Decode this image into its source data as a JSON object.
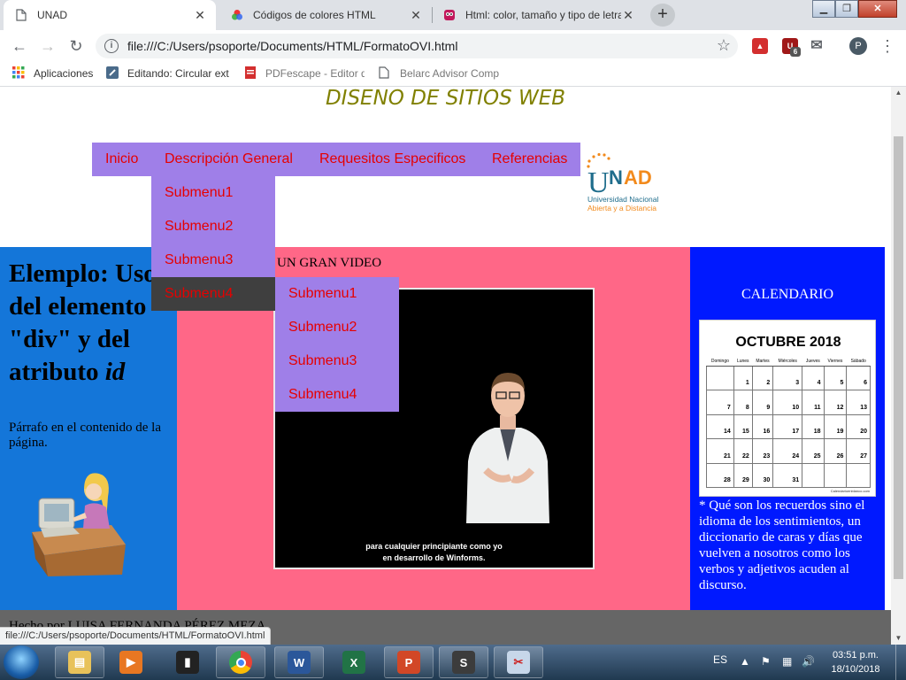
{
  "browser": {
    "tabs": [
      {
        "title": "UNAD",
        "active": true,
        "icon": "document-icon"
      },
      {
        "title": "Códigos de colores HTML",
        "active": false,
        "icon": "color-wheel-icon"
      },
      {
        "title": "Html: color, tamaño y tipo de letra",
        "active": false,
        "icon": "owl-icon"
      }
    ],
    "new_tab_label": "+",
    "window_controls": {
      "minimize": "▁",
      "maximize": "❐",
      "close": "✕"
    },
    "address": "file:///C:/Users/psoporte/Documents/HTML/FormatoOVI.html",
    "extension_badge": "6",
    "profile_initial": "P",
    "bookmarks": [
      {
        "label": "Aplicaciones",
        "icon": "apps-grid-icon"
      },
      {
        "label": "Editando: Circular ext",
        "icon": "editor-icon"
      },
      {
        "label": "PDFescape - Editor d",
        "icon": "pdf-icon"
      },
      {
        "label": "Belarc Advisor Compu",
        "icon": "document-icon"
      }
    ],
    "status_url": "file:///C:/Users/psoporte/Documents/HTML/FormatoOVI.html"
  },
  "page": {
    "title": "DISENO DE SITIOS WEB",
    "menu": [
      {
        "label": "Inicio"
      },
      {
        "label": "Descripción General"
      },
      {
        "label": "Requesitos Especificos"
      },
      {
        "label": "Referencias"
      }
    ],
    "submenu_1": [
      "Submenu1",
      "Submenu2",
      "Submenu3",
      "Submenu4"
    ],
    "submenu_2": [
      "Submenu1",
      "Submenu2",
      "Submenu3",
      "Submenu4"
    ],
    "logo": {
      "brand": "UNAD",
      "line1": "Universidad Nacional",
      "line2": "Abierta y a Distancia"
    },
    "left": {
      "heading_prefix": "Elemplo: Uso del elemento \"div\" y del atributo ",
      "heading_em": "id",
      "paragraph": "Párrafo en el contenido de la página."
    },
    "middle": {
      "video_title": "UN GRAN VIDEO",
      "caption_line1": "para cualquier principiante como yo",
      "caption_line2": "en desarrollo de Winforms."
    },
    "right": {
      "calendar_title": "CALENDARIO",
      "calendar": {
        "month": "OCTUBRE 2018",
        "days": [
          "Domingo",
          "Lunes",
          "Martes",
          "Miércoles",
          "Jueves",
          "Viernes",
          "Sábado"
        ],
        "weeks": [
          [
            "",
            "1",
            "2",
            "3",
            "4",
            "5",
            "6"
          ],
          [
            "7",
            "8",
            "9",
            "10",
            "11",
            "12",
            "13"
          ],
          [
            "14",
            "15",
            "16",
            "17",
            "18",
            "19",
            "20"
          ],
          [
            "21",
            "22",
            "23",
            "24",
            "25",
            "26",
            "27"
          ],
          [
            "28",
            "29",
            "30",
            "31",
            "",
            "",
            ""
          ]
        ],
        "source": "Calendarioenblanco.com"
      },
      "quote": "* Qué son los recuerdos sino el idioma de los sentimientos, un diccionario de caras y días que vuelven a nosotros como los verbos y adjetivos acuden al discurso."
    },
    "footer": "Hecho por LUISA FERNANDA PÉREZ MEZA"
  },
  "colors": {
    "menu_bg": "#9f7fe8",
    "menu_text": "#e60000",
    "submenu_hover": "#3f3f3f",
    "left_col": "#1476d9",
    "mid_col": "#ff6787",
    "right_col": "#0019ff",
    "footer": "#666666",
    "title": "#808000"
  },
  "taskbar": {
    "apps": [
      "file-explorer-icon",
      "media-player-icon",
      "server-icon",
      "chrome-icon",
      "word-icon",
      "excel-icon",
      "powerpoint-icon",
      "terminal-icon",
      "paint-icon"
    ],
    "language": "ES",
    "time": "03:51 p.m.",
    "date": "18/10/2018"
  }
}
